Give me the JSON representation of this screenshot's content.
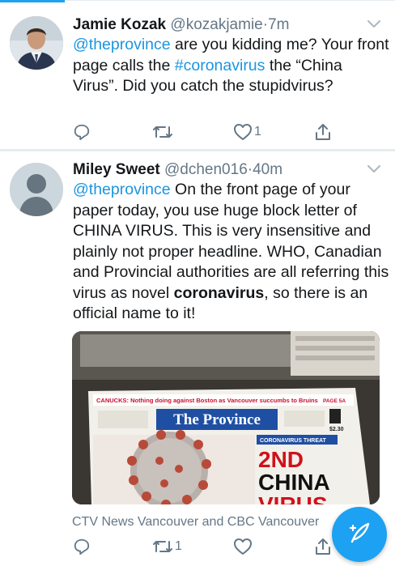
{
  "tweets": [
    {
      "author_name": "Jamie Kozak",
      "author_handle": "@kozakjamie",
      "separator": "·",
      "time": "7m",
      "text_parts": [
        {
          "text": "@theprovince",
          "kind": "link"
        },
        {
          "text": " are you kidding me? Your front page calls the ",
          "kind": "plain"
        },
        {
          "text": "#coronavirus",
          "kind": "link"
        },
        {
          "text": " the “China Virus”. Did you catch the stupidvirus?",
          "kind": "plain"
        }
      ],
      "actions": {
        "reply_icon": "reply-icon",
        "retweet_icon": "retweet-icon",
        "retweet_count": "",
        "like_icon": "heart-icon",
        "like_count": "1",
        "share_icon": "share-icon"
      }
    },
    {
      "author_name": "Miley Sweet",
      "author_handle": "@dchen016",
      "separator": "·",
      "time": "40m",
      "text_parts": [
        {
          "text": "@theprovince",
          "kind": "link"
        },
        {
          "text": "  On the front page of your paper today, you use huge block letter of CHINA VIRUS. This is very insensitive and plainly not proper headline. WHO, Canadian and Provincial authorities are all referring this virus as novel ",
          "kind": "plain"
        },
        {
          "text": "coronavirus",
          "kind": "bold"
        },
        {
          "text": ", so there is an official name to it!",
          "kind": "plain"
        }
      ],
      "media": {
        "kind": "photo",
        "newspaper": {
          "banner": "CANUCKS: Nothing doing against Boston as Vancouver succumbs to Bruins",
          "banner_page": "PAGE 5A",
          "masthead": "The Province",
          "price": "$2.30",
          "section_label": "CORONAVIRUS THREAT",
          "headline_line1": "2ND",
          "headline_line2": "CHINA",
          "headline_line3": "VIRUS"
        }
      },
      "caption": "CTV News Vancouver and CBC Vancouver",
      "actions": {
        "reply_icon": "reply-icon",
        "retweet_icon": "retweet-icon",
        "retweet_count": "1",
        "like_icon": "heart-icon",
        "like_count": "",
        "share_icon": "share-icon"
      }
    }
  ],
  "compose_button": {
    "icon": "compose-feather-icon"
  },
  "colors": {
    "accent": "#1da1f2",
    "link": "#1b95e0",
    "text": "#14171a",
    "muted": "#657786",
    "divider": "#e6ecf0"
  }
}
